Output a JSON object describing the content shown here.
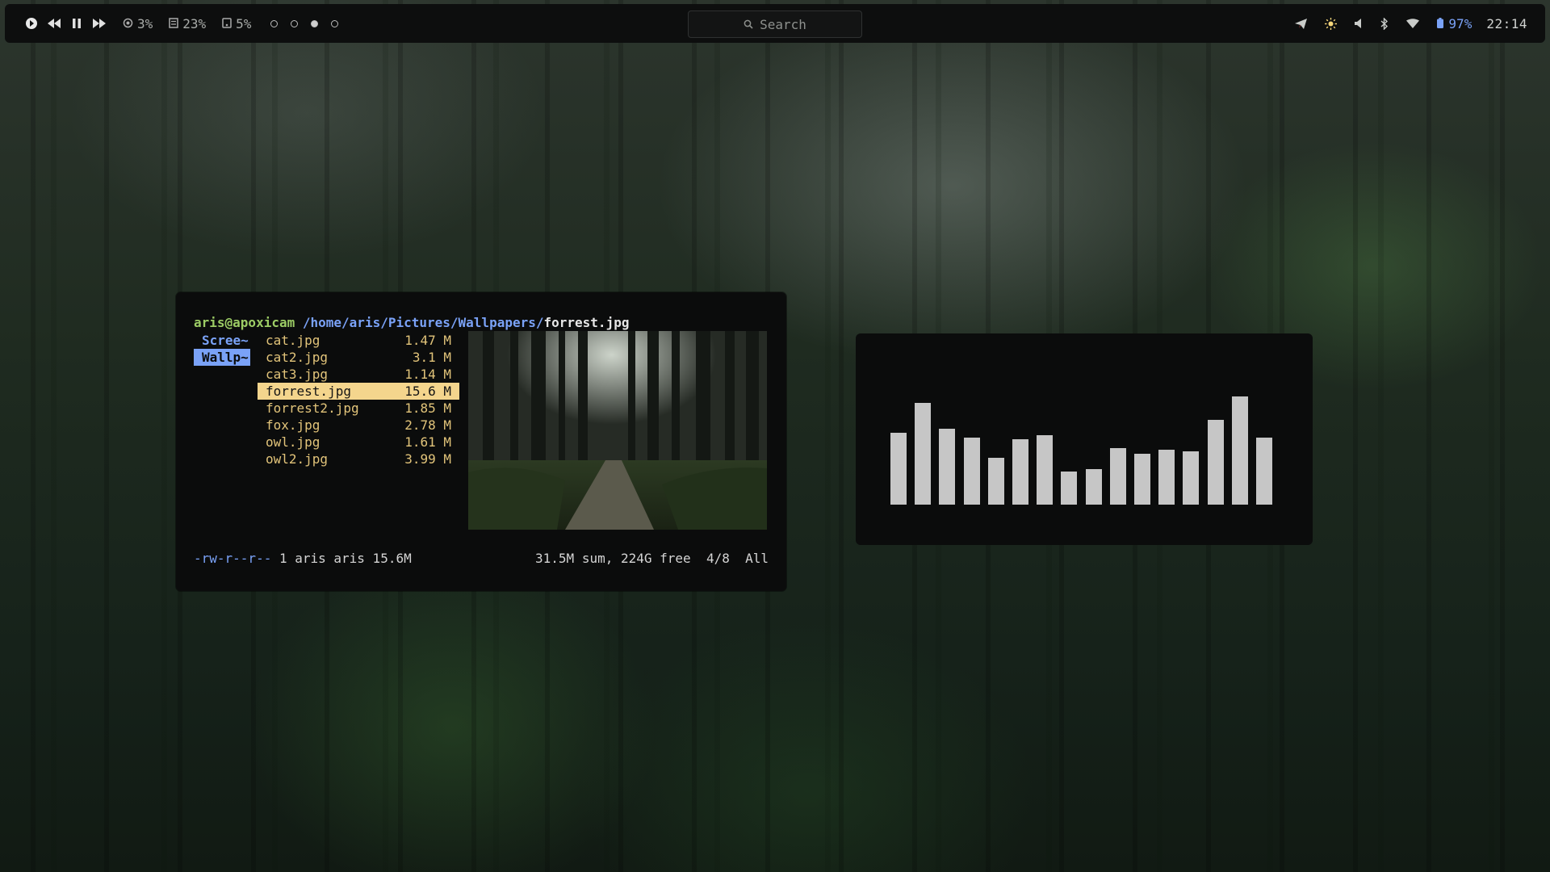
{
  "topbar": {
    "cpu": "3%",
    "mem": "23%",
    "disk": "5%",
    "workspaces": [
      false,
      false,
      true,
      false
    ],
    "search_placeholder": "Search",
    "battery": "97%",
    "clock": "22:14"
  },
  "terminal": {
    "prompt_user": "aris@apoxicam",
    "prompt_path": "/home/aris/Pictures/Wallpapers/",
    "prompt_file": "forrest.jpg",
    "dirs": [
      "Scree~",
      "Wallp~"
    ],
    "files": [
      {
        "name": "cat.jpg",
        "size": "1.47 M"
      },
      {
        "name": "cat2.jpg",
        "size": "3.1 M"
      },
      {
        "name": "cat3.jpg",
        "size": "1.14 M"
      },
      {
        "name": "forrest.jpg",
        "size": "15.6 M"
      },
      {
        "name": "forrest2.jpg",
        "size": "1.85 M"
      },
      {
        "name": "fox.jpg",
        "size": "2.78 M"
      },
      {
        "name": "owl.jpg",
        "size": "1.61 M"
      },
      {
        "name": "owl2.jpg",
        "size": "3.99 M"
      }
    ],
    "status_left": "-rw-r--r--",
    "status_owner": " 1 aris aris 15.6M",
    "status_right": "31.5M sum, 224G free  4/8  All"
  },
  "visualizer": {
    "levels": [
      0.55,
      0.78,
      0.58,
      0.51,
      0.36,
      0.5,
      0.53,
      0.25,
      0.27,
      0.43,
      0.39,
      0.42,
      0.41,
      0.65,
      0.83,
      0.51
    ]
  }
}
